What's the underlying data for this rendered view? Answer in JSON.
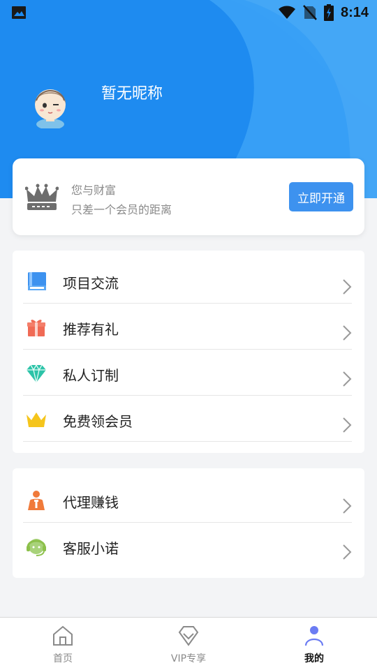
{
  "status_bar": {
    "time": "8:14",
    "icons": [
      "image-icon",
      "wifi-icon",
      "no-sim-icon",
      "battery-charging-icon"
    ]
  },
  "profile": {
    "nickname": "暂无昵称",
    "avatar_icon": "cartoon-avatar-icon"
  },
  "vip_card": {
    "icon": "crown-icon",
    "line1": "您与财富",
    "line2": "只差一个会员的距离",
    "button_label": "立即开通"
  },
  "menu_group_1": [
    {
      "label": "项目交流",
      "icon": "book-icon",
      "color": "#3d92ef"
    },
    {
      "label": "推荐有礼",
      "icon": "gift-icon",
      "color": "#f06a55"
    },
    {
      "label": "私人订制",
      "icon": "diamond-icon",
      "color": "#2cc3a8"
    },
    {
      "label": "免费领会员",
      "icon": "crown-icon",
      "color": "#f5c51c"
    }
  ],
  "menu_group_2": [
    {
      "label": "代理赚钱",
      "icon": "agent-icon",
      "color": "#f07a3a"
    },
    {
      "label": "客服小诺",
      "icon": "headset-icon",
      "color": "#8cc04a"
    }
  ],
  "tabbar": {
    "items": [
      {
        "label": "首页",
        "icon": "home-icon"
      },
      {
        "label": "VIP专享",
        "icon": "vip-diamond-icon"
      },
      {
        "label": "我的",
        "icon": "user-icon"
      }
    ],
    "active_index": 2
  },
  "colors": {
    "header_blue": "#1f8cf0",
    "accent_blue": "#3d92ef",
    "page_bg": "#f3f4f6"
  }
}
